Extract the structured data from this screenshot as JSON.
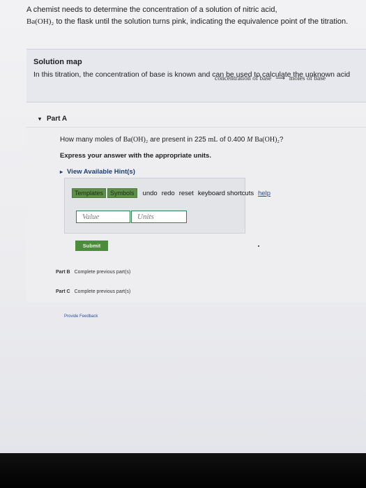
{
  "intro": {
    "line1_prefix": "A chemist needs to determine the concentration of a solution of nitric acid,",
    "line1_suffix": "",
    "line2_formula": "Ba(OH)₂",
    "line2_rest": " to the flask until the solution turns pink, indicating the equivalence point of the titration."
  },
  "solution_map": {
    "title": "Solution map",
    "text": "In this titration, the concentration of base is known and can be used to calculate the unknown acid",
    "eq_left": "concentration of base",
    "arrow": "⟶",
    "eq_right": "moles of base"
  },
  "part_a": {
    "label": "Part A",
    "question_prefix": "How many moles of ",
    "question_formula": "Ba(OH)₂",
    "question_mid": " are present in 225 ",
    "question_unit": "mL",
    "question_of": " of 0.400 ",
    "question_molar": "M",
    "question_formula2": "Ba(OH)₂",
    "question_end": "?",
    "express": "Express your answer with the appropriate units.",
    "hints": "View Available Hint(s)",
    "toolbar": {
      "templates": "Templates",
      "symbols": "Symbols",
      "undo": "undo",
      "redo": "redo",
      "reset": "reset",
      "shortcuts": "keyboard shortcuts",
      "help": "help"
    },
    "value_placeholder": "Value",
    "units_placeholder": "Units",
    "submit": "Submit"
  },
  "part_b": {
    "label": "Part B",
    "text": "Complete previous part(s)"
  },
  "part_c": {
    "label": "Part C",
    "text": "Complete previous part(s)"
  },
  "feedback": "Provide Feedback"
}
